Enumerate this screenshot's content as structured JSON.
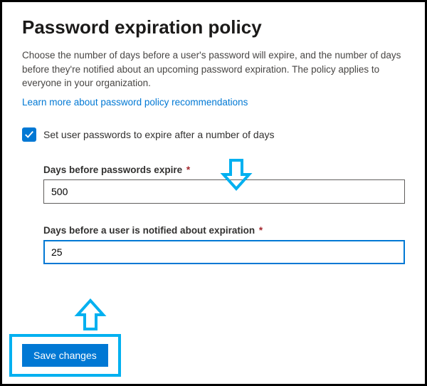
{
  "page": {
    "title": "Password expiration policy",
    "description": "Choose the number of days before a user's password will expire, and the number of days before they're notified about an upcoming password expiration. The policy applies to everyone in your organization.",
    "link_text": "Learn more about password policy recommendations"
  },
  "checkbox": {
    "label": "Set user passwords to expire after a number of days",
    "checked": true
  },
  "fields": {
    "expire_days": {
      "label": "Days before passwords expire",
      "value": "500",
      "required_mark": "*"
    },
    "notify_days": {
      "label": "Days before a user is notified about expiration",
      "value": "25",
      "required_mark": "*"
    }
  },
  "actions": {
    "save_label": "Save changes"
  },
  "colors": {
    "primary": "#0078d4",
    "highlight": "#00b0f0",
    "required": "#a4262c"
  }
}
